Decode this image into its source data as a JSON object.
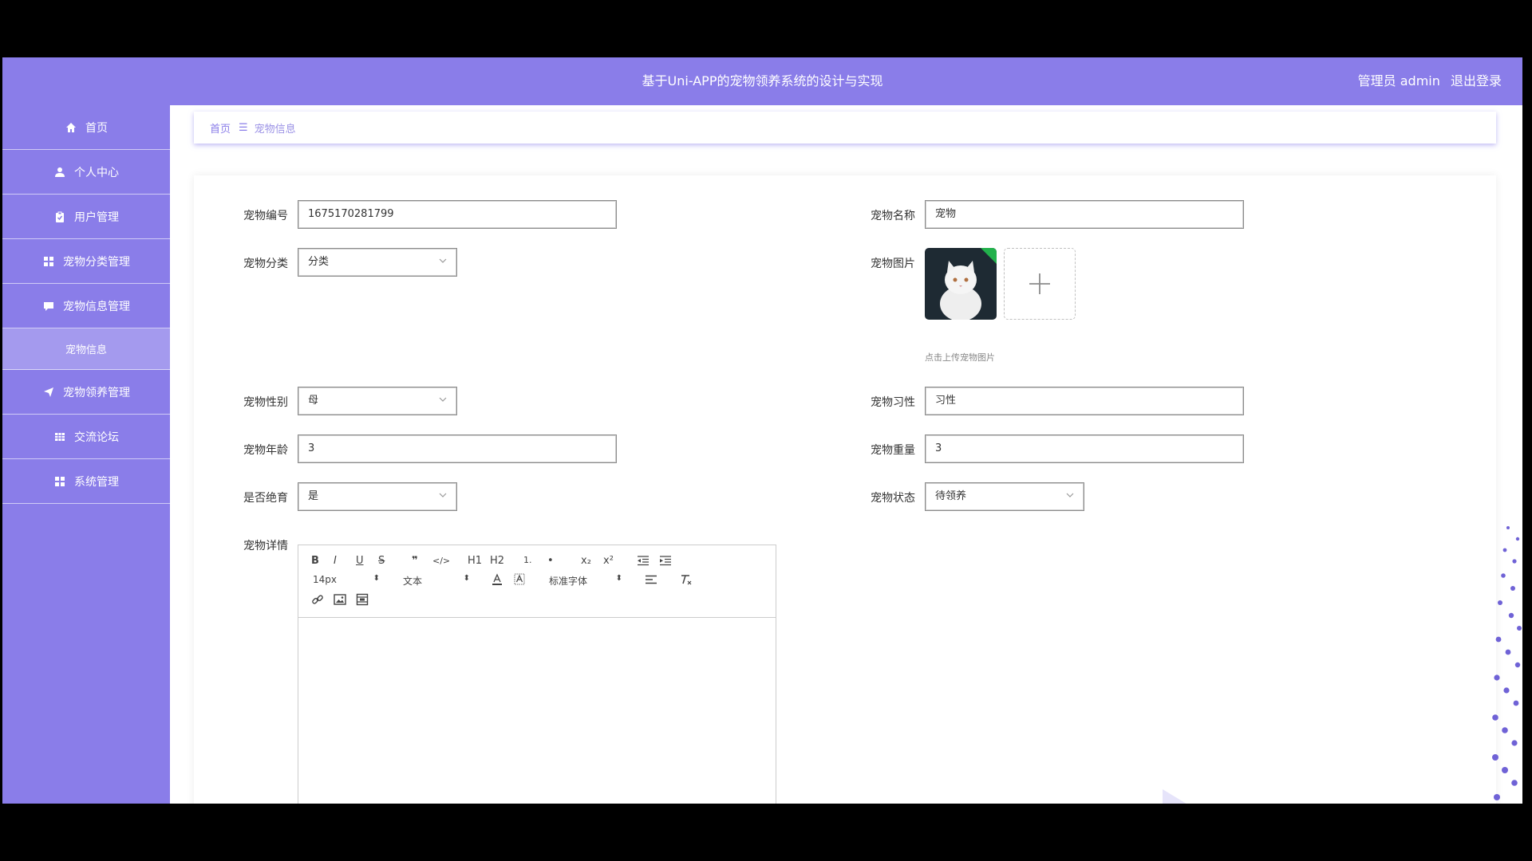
{
  "header": {
    "title": "基于Uni-APP的宠物领养系统的设计与实现",
    "user_label": "管理员 admin",
    "logout_label": "退出登录"
  },
  "sidebar": {
    "items": [
      {
        "label": "首页",
        "icon": "home-icon"
      },
      {
        "label": "个人中心",
        "icon": "user-icon"
      },
      {
        "label": "用户管理",
        "icon": "clipboard-icon"
      },
      {
        "label": "宠物分类管理",
        "icon": "grid-icon"
      },
      {
        "label": "宠物信息管理",
        "icon": "chat-icon"
      },
      {
        "label": "宠物信息",
        "icon": ""
      },
      {
        "label": "宠物领养管理",
        "icon": "send-icon"
      },
      {
        "label": "交流论坛",
        "icon": "table-icon"
      },
      {
        "label": "系统管理",
        "icon": "grid-icon"
      }
    ]
  },
  "breadcrumb": {
    "home": "首页",
    "separator": "☰",
    "current": "宠物信息"
  },
  "form": {
    "pet_id": {
      "label": "宠物编号",
      "value": "1675170281799"
    },
    "pet_name": {
      "label": "宠物名称",
      "value": "宠物"
    },
    "pet_category": {
      "label": "宠物分类",
      "value": "分类"
    },
    "pet_image": {
      "label": "宠物图片",
      "hint": "点击上传宠物图片"
    },
    "pet_gender": {
      "label": "宠物性别",
      "value": "母"
    },
    "pet_habit": {
      "label": "宠物习性",
      "value": "习性"
    },
    "pet_age": {
      "label": "宠物年龄",
      "value": "3"
    },
    "pet_weight": {
      "label": "宠物重量",
      "value": "3"
    },
    "neutered": {
      "label": "是否绝育",
      "value": "是"
    },
    "pet_status": {
      "label": "宠物状态",
      "value": "待领养"
    },
    "pet_detail": {
      "label": "宠物详情"
    }
  },
  "editor": {
    "font_size": "14px",
    "header_select": "文本",
    "font_family": "标准字体",
    "buttons": [
      "B",
      "I",
      "U",
      "S",
      "❞",
      "</>",
      "H1",
      "H2",
      "1.",
      "•",
      "x₂",
      "x²"
    ]
  },
  "colors": {
    "primary": "#8a7de9",
    "submenu_active": "#a49aee"
  }
}
